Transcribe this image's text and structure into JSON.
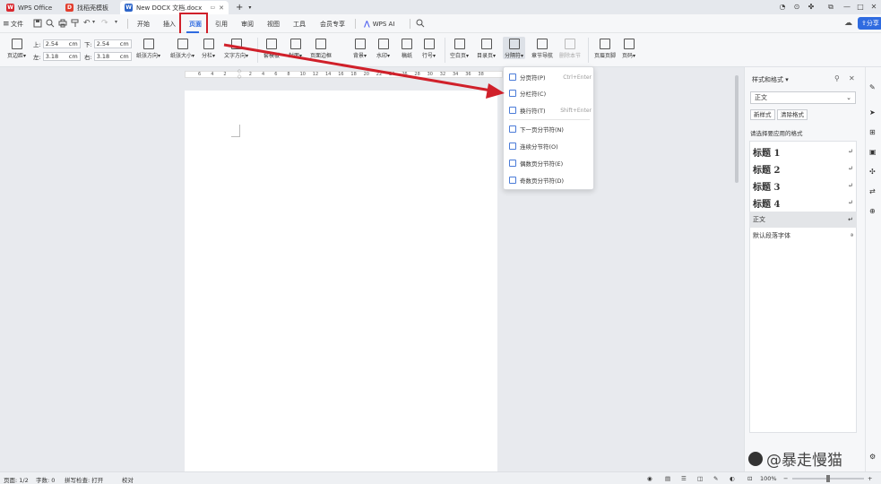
{
  "titlebar": {
    "tabs": [
      {
        "label": "WPS Office",
        "icon": "wps-logo-icon",
        "color": "#d9282f"
      },
      {
        "label": "找稻壳模板",
        "icon": "docer-icon",
        "color": "#e23e2e"
      },
      {
        "label": "New DOCX 文档.docx",
        "icon": "word-doc-icon",
        "color": "#2d65c9"
      }
    ],
    "add_tab": "+"
  },
  "menubar": {
    "file_label": "文件",
    "tabs": [
      "开始",
      "插入",
      "页面",
      "引用",
      "审阅",
      "视图",
      "工具",
      "会员专享"
    ],
    "active_tab": "页面",
    "ai_label": "WPS AI",
    "share_label": "分享"
  },
  "ribbon": {
    "margin_label": "页边距",
    "margins": {
      "top_label": "上:",
      "top_value": "2.54",
      "top_unit": "cm",
      "bottom_label": "下:",
      "bottom_value": "2.54",
      "bottom_unit": "cm",
      "left_label": "左:",
      "left_value": "3.18",
      "left_unit": "cm",
      "right_label": "右:",
      "right_value": "3.18",
      "right_unit": "cm"
    },
    "buttons": {
      "orientation": "纸张方向",
      "size": "纸张大小",
      "columns": "分栏",
      "text_dir": "文字方向",
      "line_num": "行号",
      "theme": "套模板",
      "cover": "封面",
      "page_border": "页面边框",
      "background": "背景",
      "watermark": "水印",
      "manuscript": "稿纸",
      "blank_page": "空白页",
      "toc_page": "目录页",
      "break": "分隔符",
      "chapter_nav": "章节导航",
      "delete_section": "删除本节",
      "header_footer": "页眉页脚",
      "page_num": "页码"
    }
  },
  "dropdown": {
    "items": [
      {
        "label": "分页符(P)",
        "shortcut": "Ctrl+Enter"
      },
      {
        "label": "分栏符(C)",
        "shortcut": ""
      },
      {
        "label": "换行符(T)",
        "shortcut": "Shift+Enter"
      },
      {
        "label": "下一页分节符(N)",
        "shortcut": ""
      },
      {
        "label": "连续分节符(O)",
        "shortcut": ""
      },
      {
        "label": "偶数页分节符(E)",
        "shortcut": ""
      },
      {
        "label": "奇数页分节符(D)",
        "shortcut": ""
      }
    ]
  },
  "ruler": {
    "ticks": [
      "6",
      "4",
      "2",
      "",
      "2",
      "4",
      "6",
      "8",
      "10",
      "12",
      "14",
      "16",
      "18",
      "20",
      "22",
      "24",
      "26",
      "28",
      "30",
      "32",
      "34",
      "36",
      "38"
    ]
  },
  "panel": {
    "title": "样式和格式",
    "current_style": "正文",
    "new_style_btn": "新样式",
    "clear_btn": "清除格式",
    "apply_label": "请选择要应用的格式",
    "styles": [
      {
        "label": "标题 1",
        "heading": true
      },
      {
        "label": "标题 2",
        "heading": true
      },
      {
        "label": "标题 3",
        "heading": true
      },
      {
        "label": "标题 4",
        "heading": true
      },
      {
        "label": "正文",
        "heading": false,
        "selected": true
      },
      {
        "label": "默认段落字体",
        "heading": false
      }
    ]
  },
  "watermark": "@暴走慢猫",
  "statusbar": {
    "page": "页面: 1/2",
    "words": "字数: 0",
    "spell": "拼写检查: 打开",
    "proof": "校对",
    "zoom": "100%"
  },
  "colors": {
    "accent": "#2f6be0",
    "annotation": "#d0202a"
  }
}
